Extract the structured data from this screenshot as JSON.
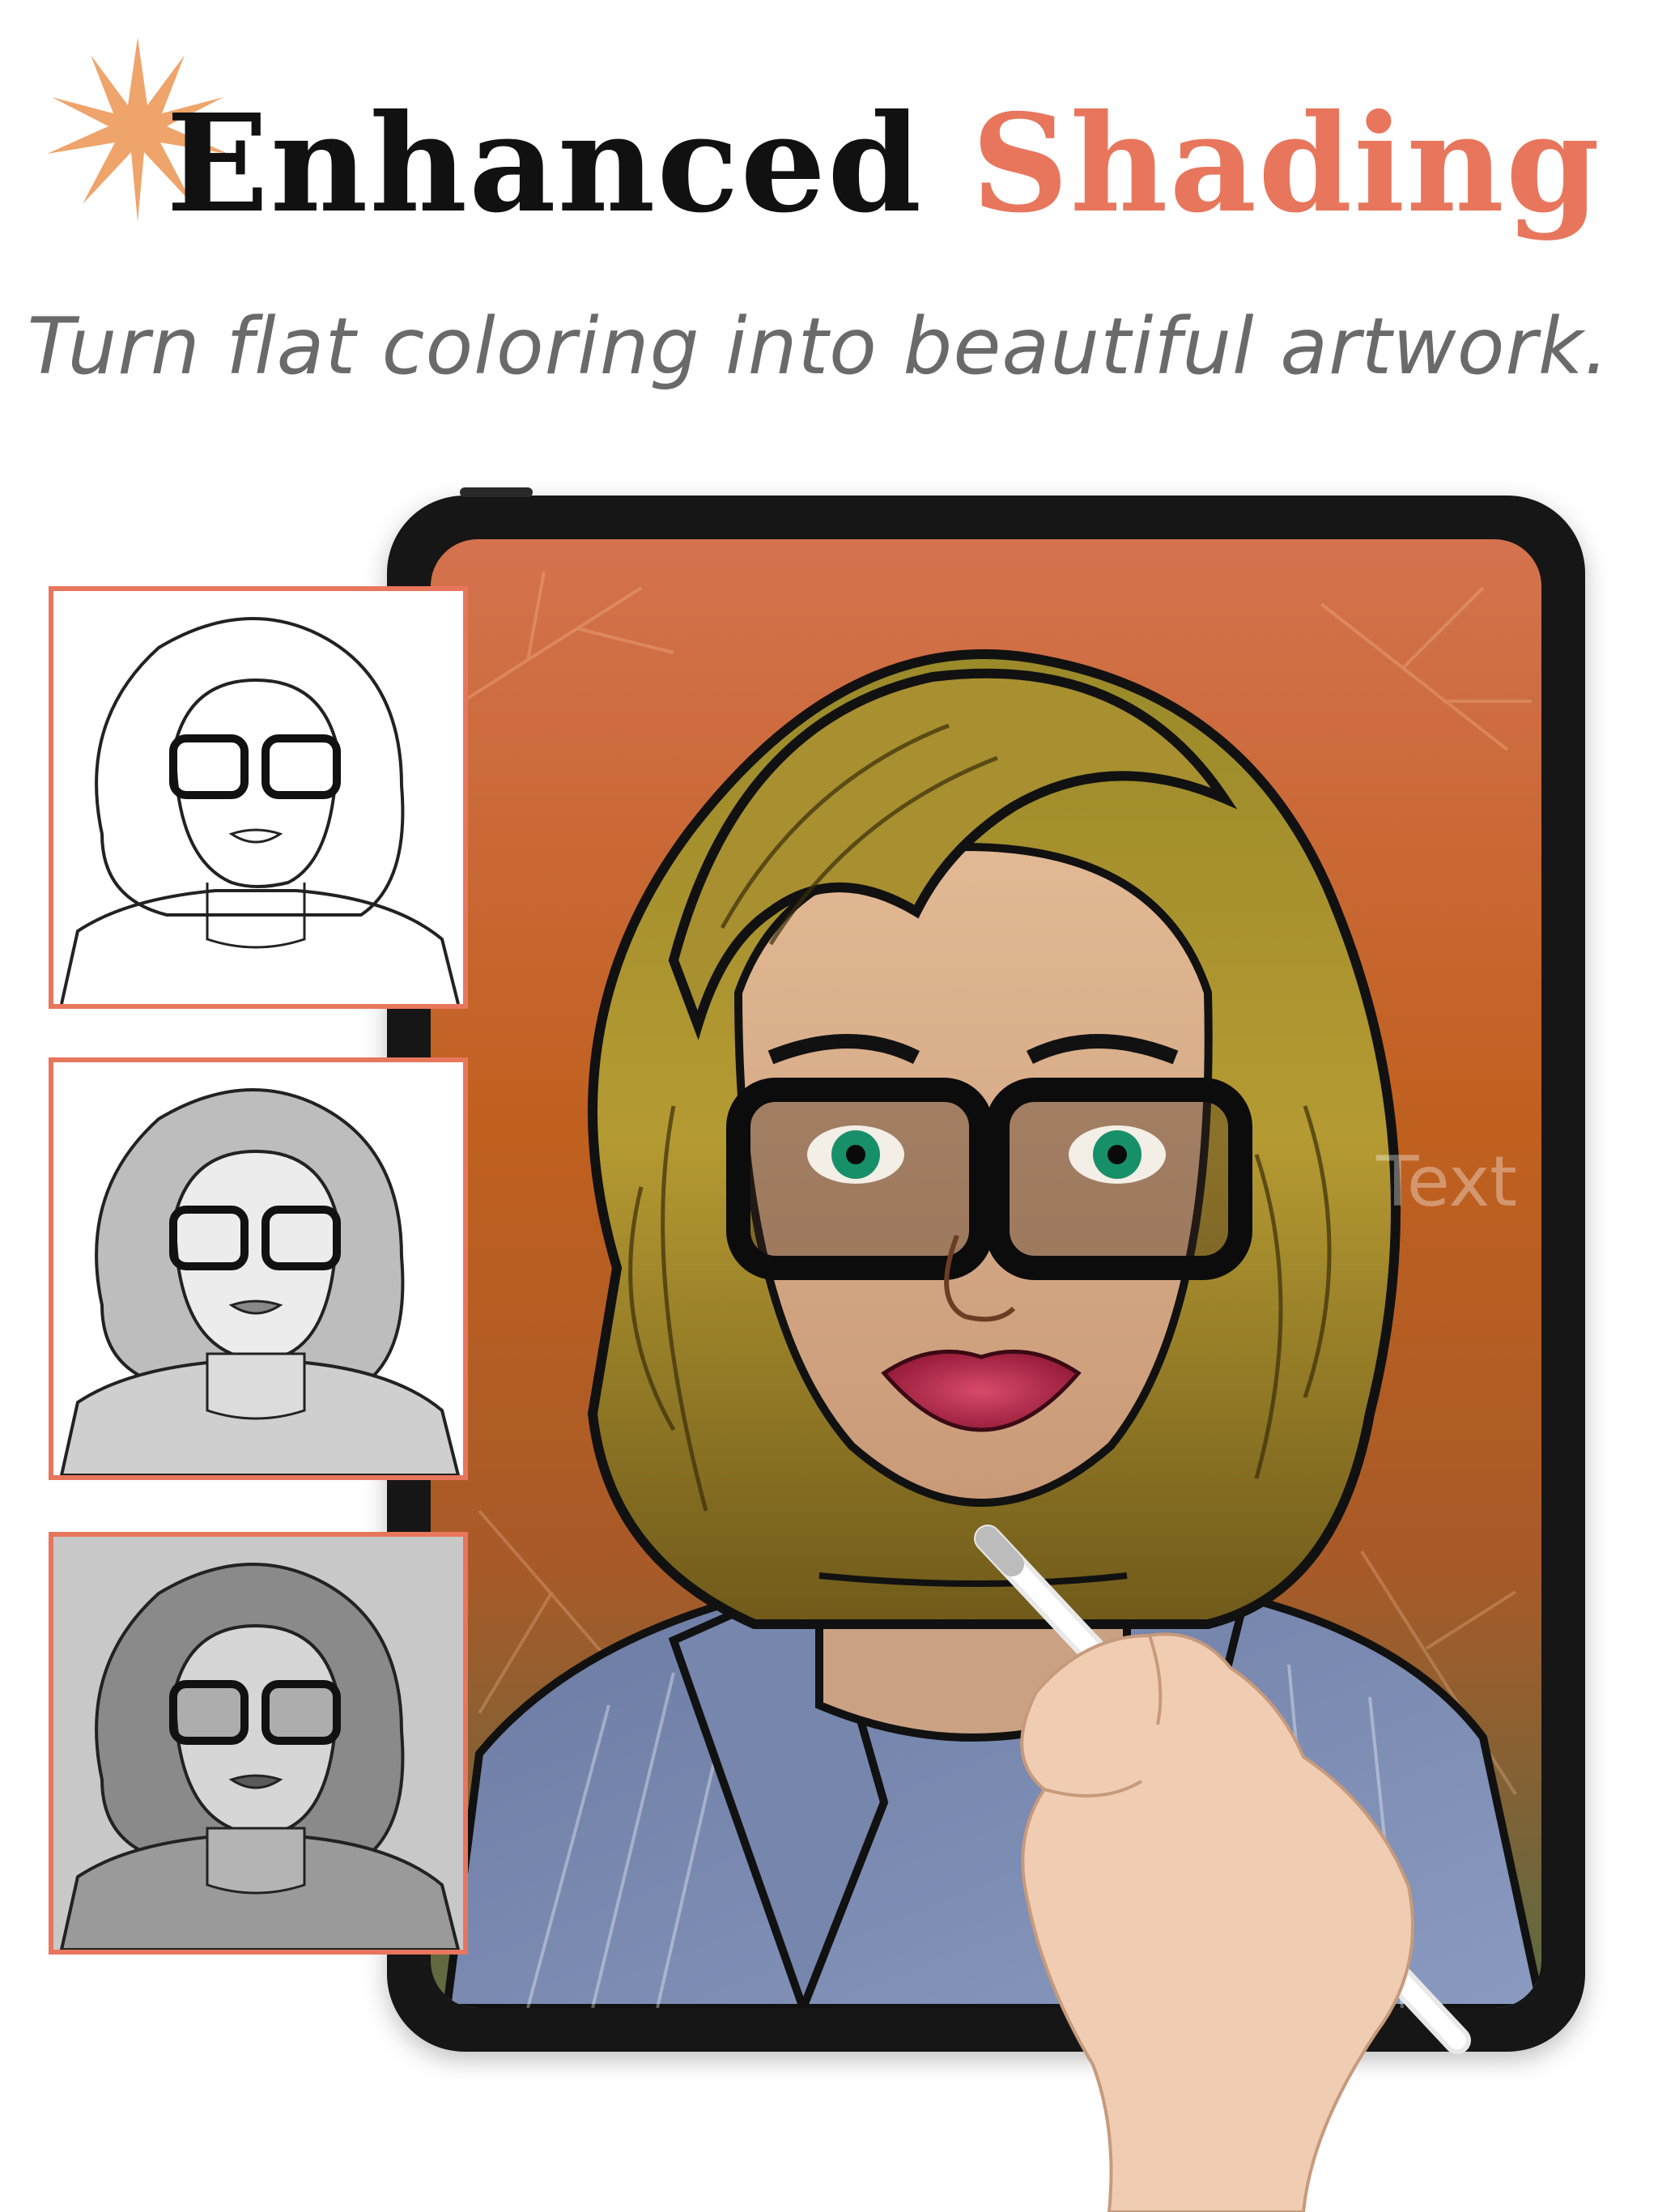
{
  "header": {
    "title_part1": "Enhanced",
    "title_part2": "Shading",
    "subtitle": "Turn flat coloring into beautiful artwork."
  },
  "tablet": {
    "watermark": "Text"
  },
  "thumbnails": [
    {
      "style": "line-art"
    },
    {
      "style": "light-shading"
    },
    {
      "style": "full-grayscale"
    }
  ],
  "colors": {
    "accent": "#e8765c",
    "sun": "#eea46a",
    "title": "#111111",
    "subtitle": "#6a6a6a"
  },
  "icons": [
    "sun-burst-icon"
  ]
}
